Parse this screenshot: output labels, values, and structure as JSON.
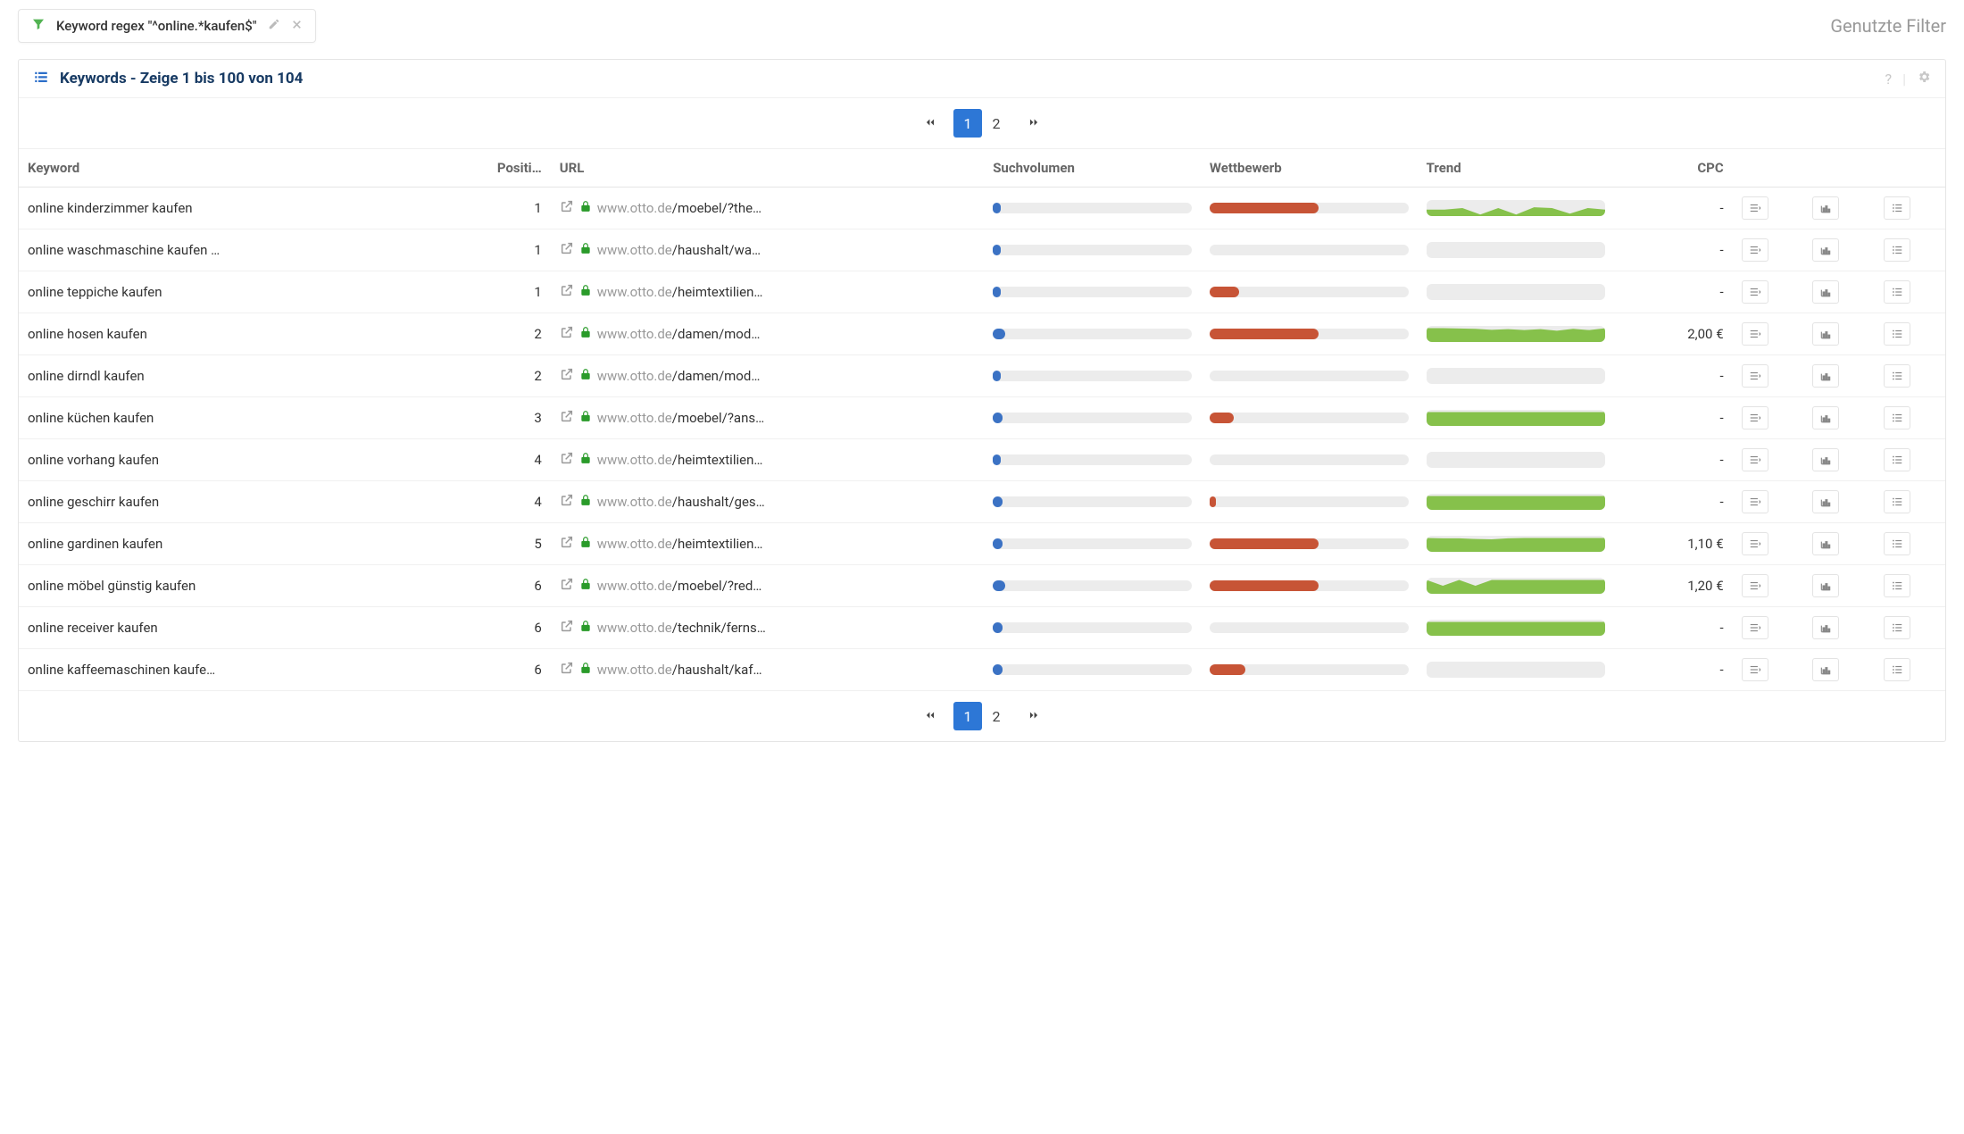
{
  "topbar": {
    "filter_label": "Keyword regex \"^online.*kaufen$\"",
    "used_filters": "Genutzte Filter"
  },
  "panel": {
    "title": "Keywords - Zeige 1 bis 100 von 104"
  },
  "pagination": {
    "pages": [
      "1",
      "2"
    ],
    "active": 0
  },
  "columns": {
    "keyword": "Keyword",
    "position": "Positi…",
    "url": "URL",
    "volume": "Suchvolumen",
    "competition": "Wettbewerb",
    "trend": "Trend",
    "cpc": "CPC"
  },
  "rows": [
    {
      "keyword": "online kinderzimmer kaufen",
      "position": "1",
      "domain": "www.otto.de",
      "path": "/moebel/?the…",
      "vol_pct": 4,
      "comp_pct": 55,
      "trend": [
        40,
        40,
        50,
        10,
        50,
        10,
        55,
        50,
        15,
        50,
        40
      ],
      "cpc": "-"
    },
    {
      "keyword": "online waschmaschine kaufen …",
      "position": "1",
      "domain": "www.otto.de",
      "path": "/haushalt/wa…",
      "vol_pct": 4,
      "comp_pct": 0,
      "trend": [],
      "cpc": "-"
    },
    {
      "keyword": "online teppiche kaufen",
      "position": "1",
      "domain": "www.otto.de",
      "path": "/heimtextilien…",
      "vol_pct": 4,
      "comp_pct": 15,
      "trend": [],
      "cpc": "-"
    },
    {
      "keyword": "online hosen kaufen",
      "position": "2",
      "domain": "www.otto.de",
      "path": "/damen/mod…",
      "vol_pct": 6,
      "comp_pct": 55,
      "trend": [
        86,
        86,
        84,
        82,
        76,
        80,
        74,
        80,
        70,
        82,
        74,
        86
      ],
      "cpc": "2,00 €"
    },
    {
      "keyword": "online dirndl kaufen",
      "position": "2",
      "domain": "www.otto.de",
      "path": "/damen/mod…",
      "vol_pct": 4,
      "comp_pct": 0,
      "trend": [],
      "cpc": "-"
    },
    {
      "keyword": "online küchen kaufen",
      "position": "3",
      "domain": "www.otto.de",
      "path": "/moebel/?ans…",
      "vol_pct": 5,
      "comp_pct": 12,
      "trend": [
        86,
        86,
        86,
        86,
        86,
        86,
        86,
        86,
        86,
        86,
        86,
        86
      ],
      "cpc": "-"
    },
    {
      "keyword": "online vorhang kaufen",
      "position": "4",
      "domain": "www.otto.de",
      "path": "/heimtextilien…",
      "vol_pct": 4,
      "comp_pct": 0,
      "trend": [],
      "cpc": "-"
    },
    {
      "keyword": "online geschirr kaufen",
      "position": "4",
      "domain": "www.otto.de",
      "path": "/haushalt/ges…",
      "vol_pct": 5,
      "comp_pct": 3,
      "trend": [
        86,
        86,
        86,
        86,
        86,
        86,
        86,
        86,
        86,
        86,
        86,
        86
      ],
      "cpc": "-"
    },
    {
      "keyword": "online gardinen kaufen",
      "position": "5",
      "domain": "www.otto.de",
      "path": "/heimtextilien…",
      "vol_pct": 5,
      "comp_pct": 55,
      "trend": [
        86,
        84,
        84,
        80,
        78,
        84,
        86,
        86,
        86,
        86,
        86,
        86
      ],
      "cpc": "1,10 €"
    },
    {
      "keyword": "online möbel günstig kaufen",
      "position": "6",
      "domain": "www.otto.de",
      "path": "/moebel/?red…",
      "vol_pct": 6,
      "comp_pct": 55,
      "trend": [
        86,
        50,
        86,
        50,
        86,
        86,
        86,
        86,
        86,
        86,
        86,
        86
      ],
      "cpc": "1,20 €"
    },
    {
      "keyword": "online receiver kaufen",
      "position": "6",
      "domain": "www.otto.de",
      "path": "/technik/ferns…",
      "vol_pct": 5,
      "comp_pct": 0,
      "trend": [
        86,
        86,
        86,
        86,
        86,
        86,
        86,
        86,
        86,
        86,
        86,
        86
      ],
      "cpc": "-"
    },
    {
      "keyword": "online kaffeemaschinen kaufe…",
      "position": "6",
      "domain": "www.otto.de",
      "path": "/haushalt/kaf…",
      "vol_pct": 5,
      "comp_pct": 18,
      "trend": [],
      "cpc": "-"
    }
  ]
}
